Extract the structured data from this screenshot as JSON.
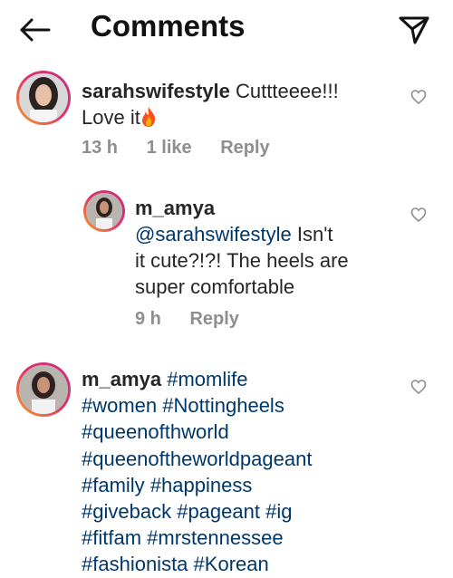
{
  "header": {
    "title": "Comments"
  },
  "comments": [
    {
      "username": "sarahswifestyle",
      "text_line1": "Cuttteeee!!!",
      "text_line2": "Love it",
      "emoji": "fire-emoji",
      "time": "13 h",
      "likes": "1 like",
      "reply": "Reply"
    },
    {
      "username": "m_amya",
      "mention": "@sarahswifestyle",
      "text_line1_rest": " Isn't",
      "text_line2": "it cute?!?! The heels are",
      "text_line3": "super comfortable",
      "time": "9 h",
      "reply": "Reply"
    },
    {
      "username": "m_amya",
      "hashtags": [
        "#momlife",
        "#women",
        "#Nottingheels",
        "#queenofthworld",
        "#queenoftheworldpageant",
        "#family",
        "#happiness",
        "#giveback",
        "#pageant",
        "#ig",
        "#fitfam",
        "#mrstennessee",
        "#fashionista",
        "#Korean"
      ]
    }
  ],
  "colors": {
    "hashtag": "#00376b",
    "meta": "#8e8e8e",
    "text": "#262626"
  }
}
